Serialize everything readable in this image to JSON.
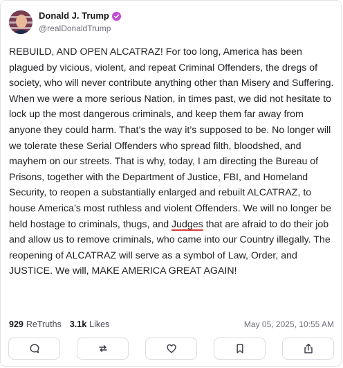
{
  "author": {
    "display_name": "Donald J. Trump",
    "handle": "@realDonaldTrump",
    "verified_color": "#c24bd6"
  },
  "post": {
    "text_before": "REBUILD, AND OPEN ALCATRAZ! For too long, America has been plagued by vicious, violent, and repeat Criminal Offenders, the dregs of society, who will never contribute anything other than Misery and Suffering. When we were a more serious Nation, in times past, we did not hesitate to lock up the most dangerous criminals, and keep them far away from anyone they could harm. That’s the way it’s supposed to be. No longer will we tolerate these Serial Offenders who spread filth, bloodshed, and mayhem on our streets. That is why, today, I am directing the Bureau of Prisons, together with the Department of Justice, FBI, and Homeland Security, to reopen a substantially enlarged and rebuilt ALCATRAZ, to house America’s most ruthless and violent Offenders. We will no longer be held hostage to criminals, thugs, and ",
    "underlined_word": "Judges",
    "text_after": " that are afraid to do their job and allow us to remove criminals, who came into our Country illegally. The reopening of ALCATRAZ will serve as a symbol of Law, Order, and JUSTICE. We will, MAKE AMERICA GREAT AGAIN!"
  },
  "stats": {
    "retruths_count": "929",
    "retruths_label": "ReTruths",
    "likes_count": "3.1k",
    "likes_label": "Likes",
    "timestamp": "May 05, 2025, 10:55 AM"
  },
  "actions": [
    {
      "icon": "reply-icon"
    },
    {
      "icon": "retruth-icon"
    },
    {
      "icon": "like-icon"
    },
    {
      "icon": "bookmark-icon"
    },
    {
      "icon": "share-icon"
    }
  ]
}
